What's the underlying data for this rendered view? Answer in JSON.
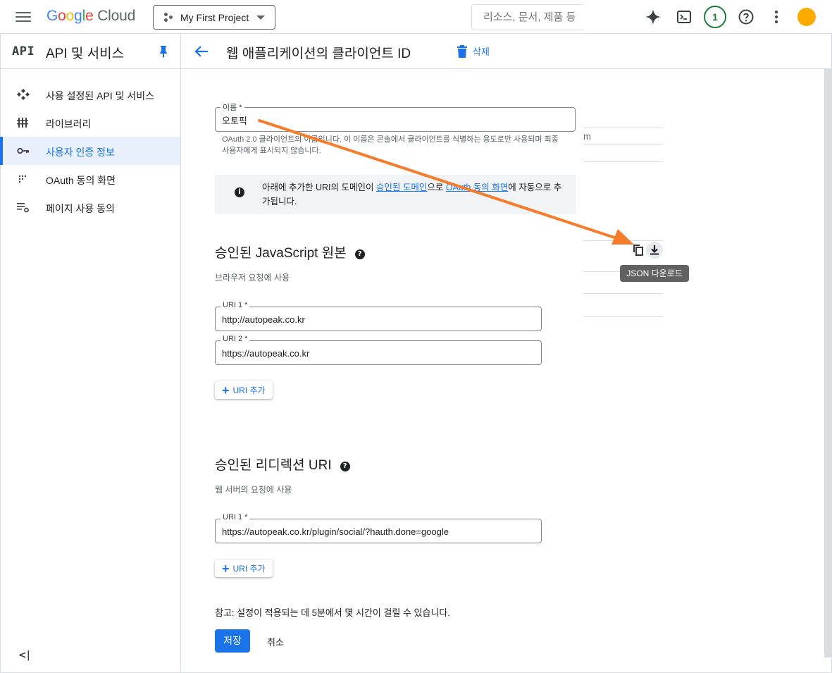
{
  "topbar": {
    "logo_google": "Google",
    "logo_cloud": "Cloud",
    "project": "My First Project",
    "search_placeholder": "리소스, 문서, 제품 등",
    "notification_count": "1"
  },
  "nav": {
    "glyph": "API",
    "title": "API 및 서비스",
    "items": [
      {
        "label": "사용 설정된 API 및 서비스",
        "icon": "diamond-dots-icon"
      },
      {
        "label": "라이브러리",
        "icon": "library-icon"
      },
      {
        "label": "사용자 인증 정보",
        "icon": "key-icon",
        "active": true
      },
      {
        "label": "OAuth 동의 화면",
        "icon": "dots-grid-icon"
      },
      {
        "label": "페이지 사용 동의",
        "icon": "settings-list-icon"
      }
    ],
    "collapse": "<|"
  },
  "header": {
    "title": "웹 애플리케이션의 클라이언트 ID",
    "delete_label": "삭제"
  },
  "form": {
    "name_label": "이름 *",
    "name_value": "오토픽",
    "name_hint": "OAuth 2.0 클라이언트의 이름입니다. 이 이름은 콘솔에서 클라이언트를 식별하는 용도로만 사용되며 최종 사용자에게 표시되지 않습니다.",
    "info_pre": "아래에 추가한 URI의 도메인이 ",
    "info_link1": "승인된 도메인",
    "info_mid": "으로 ",
    "info_link2": "OAuth 동의 화면",
    "info_post": "에 자동으로 추가됩니다.",
    "js_origins_title_pre": "승인된 ",
    "js_origins_title_bold": "JavaScript",
    "js_origins_title_post": " 원본",
    "js_origins_sub": "브라우저 요청에 사용",
    "js_uri1_label": "URI 1 *",
    "js_uri1_value": "http://autopeak.co.kr",
    "js_uri2_label": "URI 2 *",
    "js_uri2_value": "https://autopeak.co.kr",
    "add_uri_label": "URI 추가",
    "redirect_title_pre": "승인된 리디렉션 ",
    "redirect_title_bold": "URI",
    "redirect_sub": "웹 서버의 요청에 사용",
    "redirect_uri1_label": "URI 1 *",
    "redirect_uri1_value": "https://autopeak.co.kr/plugin/social/?hauth.done=google",
    "note": "참고: 설정이 적용되는 데 5분에서 몇 시간이 걸릴 수 있습니다.",
    "save_label": "저장",
    "cancel_label": "취소"
  },
  "side_panel": {
    "partial_text": "m",
    "tooltip": "JSON 다운로드"
  },
  "colors": {
    "accent": "#1a73e8",
    "annotation_arrow": "#f57c2a"
  }
}
